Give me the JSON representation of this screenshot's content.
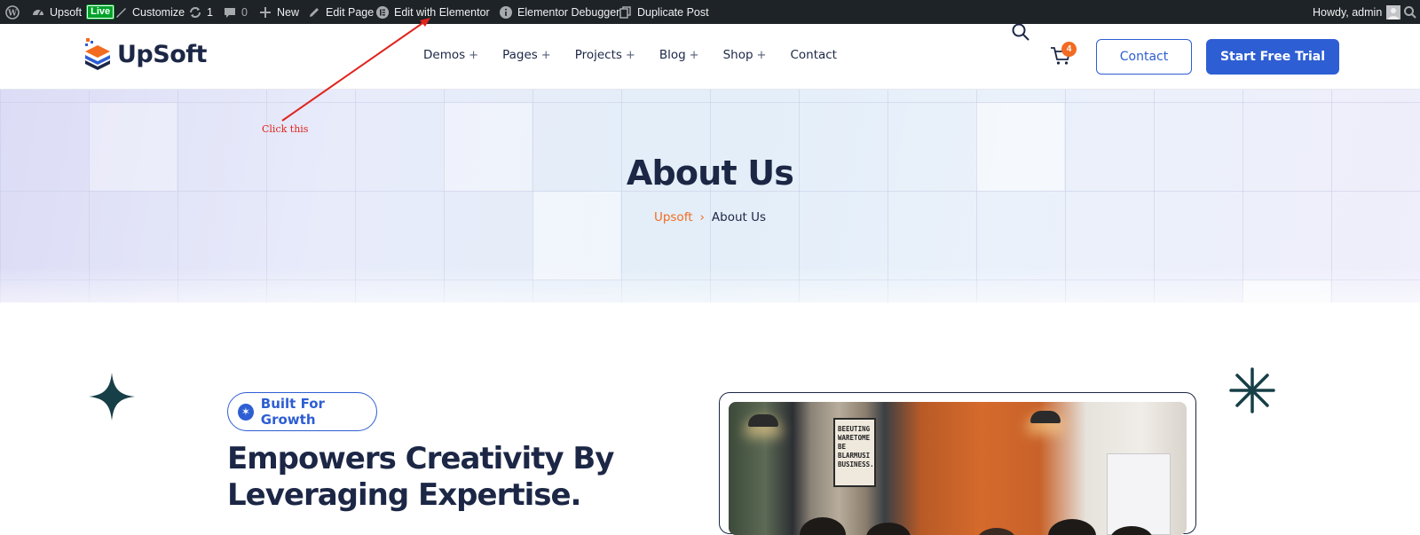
{
  "admin_bar": {
    "site_name": "Upsoft",
    "live_badge": "Live",
    "customize": "Customize",
    "updates_count": "1",
    "comments_count": "0",
    "new": "New",
    "edit_page": "Edit Page",
    "edit_with_elementor": "Edit with Elementor",
    "elementor_debugger": "Elementor Debugger",
    "duplicate_post": "Duplicate Post",
    "howdy": "Howdy, admin"
  },
  "header": {
    "logo_text": "UpSoft",
    "nav": [
      {
        "label": "Demos",
        "suffix": "+"
      },
      {
        "label": "Pages",
        "suffix": "+"
      },
      {
        "label": "Projects",
        "suffix": "+"
      },
      {
        "label": "Blog",
        "suffix": "+"
      },
      {
        "label": "Shop",
        "suffix": "+"
      },
      {
        "label": "Contact",
        "suffix": ""
      }
    ],
    "cart_count": "4",
    "contact_button": "Contact",
    "trial_button": "Start Free Trial"
  },
  "hero": {
    "title": "About Us",
    "breadcrumb_home": "Upsoft",
    "breadcrumb_sep": "›",
    "breadcrumb_current": "About Us"
  },
  "annotation": {
    "text": "Click this"
  },
  "content": {
    "pill_text": "Built For Growth",
    "headline_line1": "Empowers Creativity By",
    "headline_line2": "Leveraging Expertise.",
    "photo_sign_text": "BEEUTING WARETOME BE BLARMUSI BUSINESS."
  },
  "colors": {
    "admin_bar_bg": "#1d2327",
    "brand_blue": "#2e5ed3",
    "accent_orange": "#f26b21",
    "heading_navy": "#1c2746",
    "annotation_red": "#e0231c",
    "star_teal": "#173f47"
  },
  "icons": {
    "wp": "wordpress-icon",
    "dashboard": "dashboard-icon",
    "customize": "brush-icon",
    "updates": "refresh-icon",
    "comments": "comment-icon",
    "new": "plus-icon",
    "edit": "pencil-icon",
    "elementor": "elementor-icon",
    "debugger": "info-icon",
    "duplicate": "duplicate-icon",
    "search": "search-icon",
    "cart": "cart-icon"
  }
}
